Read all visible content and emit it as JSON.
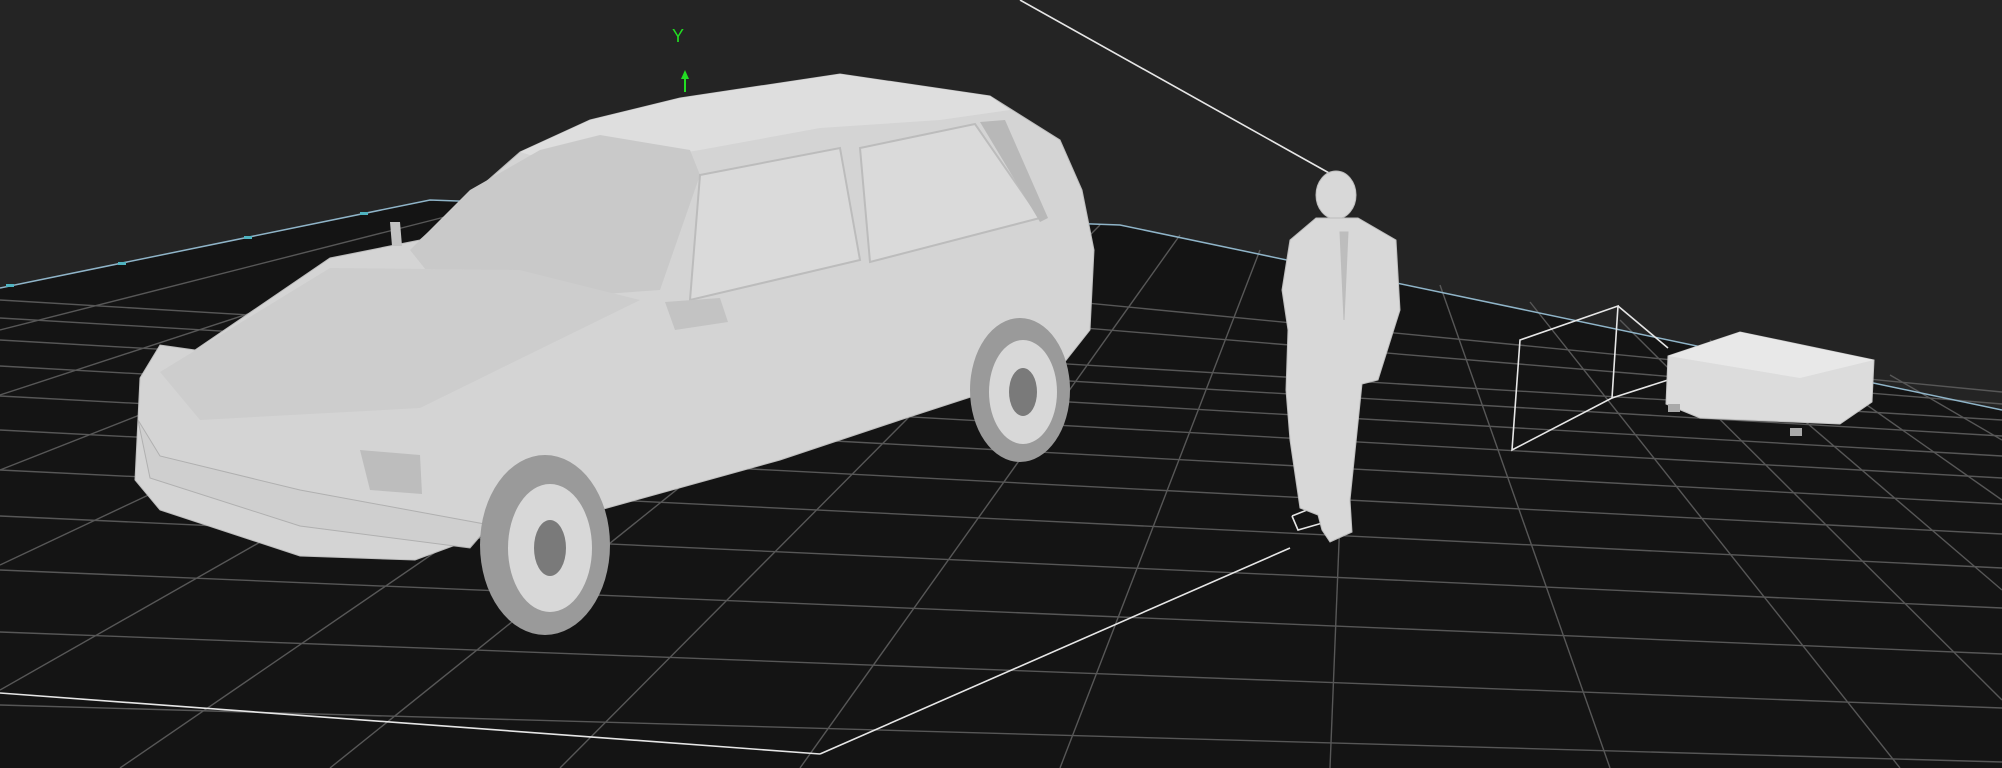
{
  "viewport": {
    "background_color": "#242424",
    "floor_color": "#141414",
    "grid_line_color": "#5a5a5a",
    "floor_edge_color": "#8fb4c8",
    "wire_color": "#e6e6e6",
    "model_color": "#d9d9d9"
  },
  "gizmo": {
    "y_axis_label": "Y",
    "y_axis_color": "#22dd22"
  },
  "scene_objects": [
    {
      "id": "car",
      "icon": "car-model-icon"
    },
    {
      "id": "person",
      "icon": "person-model-icon"
    },
    {
      "id": "camera-frustum",
      "icon": "camera-frustum-icon"
    },
    {
      "id": "projector",
      "icon": "projector-box-icon"
    }
  ]
}
